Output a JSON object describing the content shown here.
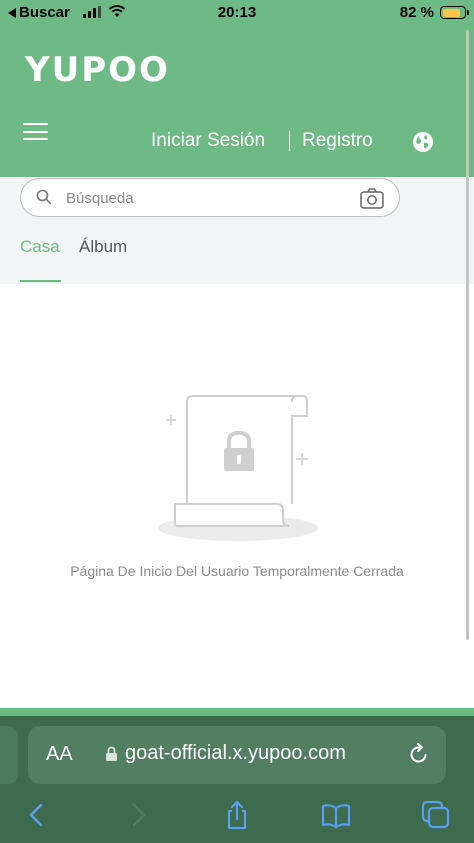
{
  "status_bar": {
    "back_label": "Buscar",
    "time": "20:13",
    "battery_text": "82 %",
    "battery_level": 0.82
  },
  "header": {
    "logo_text": "YUPOO",
    "login_label": "Iniciar Sesión",
    "register_label": "Registro",
    "globe_icon": "globe-icon",
    "menu_icon": "hamburger-menu-icon"
  },
  "search": {
    "placeholder": "Búsqueda",
    "camera_icon": "camera-icon"
  },
  "tabs": [
    {
      "label": "Casa",
      "active": true
    },
    {
      "label": "Álbum",
      "active": false
    }
  ],
  "empty_state": {
    "message": "Página De Inicio Del Usuario Temporalmente Cerrada",
    "icon": "locked-document-icon"
  },
  "safari": {
    "aa_label": "AA",
    "url": "goat-official.x.yupoo.com",
    "nav_icons": [
      "back-icon",
      "forward-icon",
      "share-icon",
      "bookmarks-icon",
      "tabs-icon"
    ]
  },
  "colors": {
    "brand_green": "#6dba85",
    "safari_bar": "#3e6a4e",
    "url_field": "#527e63",
    "safari_icons": "#5aa0f0"
  }
}
